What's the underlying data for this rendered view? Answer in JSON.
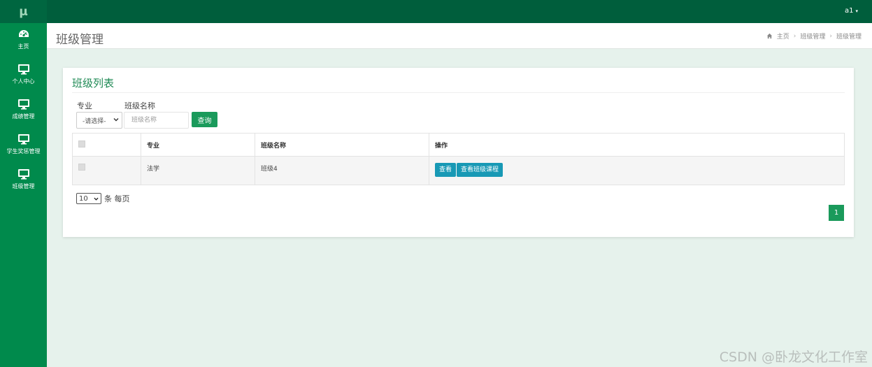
{
  "app": {
    "logo": "μ"
  },
  "topbar": {
    "user_name": "a1",
    "user_caret": "▾"
  },
  "sidebar": {
    "items": [
      {
        "label": "主页",
        "icon": "dashboard-icon"
      },
      {
        "label": "个人中心",
        "icon": "monitor-icon"
      },
      {
        "label": "成绩管理",
        "icon": "monitor-icon"
      },
      {
        "label": "学生奖惩管理",
        "icon": "monitor-icon"
      },
      {
        "label": "班级管理",
        "icon": "monitor-icon"
      }
    ]
  },
  "header": {
    "title": "班级管理",
    "breadcrumb": [
      "主页",
      "班级管理",
      "班级管理"
    ],
    "breadcrumb_sep": "›"
  },
  "panel": {
    "title": "班级列表",
    "filters": {
      "major_label": "专业",
      "major_selected": "-请选择-",
      "class_label": "班级名称",
      "class_placeholder": "班级名称",
      "class_value": "",
      "query_button": "查询"
    },
    "table": {
      "headers": [
        "",
        "专业",
        "班级名称",
        "操作"
      ],
      "rows": [
        {
          "major": "法学",
          "class_name": "班级4",
          "actions": [
            "查看",
            "查看班级课程"
          ]
        }
      ]
    },
    "pagination": {
      "page_size": "10",
      "page_size_suffix": "条 每页",
      "current_page": "1"
    }
  },
  "watermark": "CSDN @卧龙文化工作室",
  "colors": {
    "sidebar": "#008a4c",
    "topbar": "#005e3c",
    "primary_button": "#1a9a5b",
    "action_button": "#1899b5",
    "page_bg": "#e6f2ec"
  }
}
